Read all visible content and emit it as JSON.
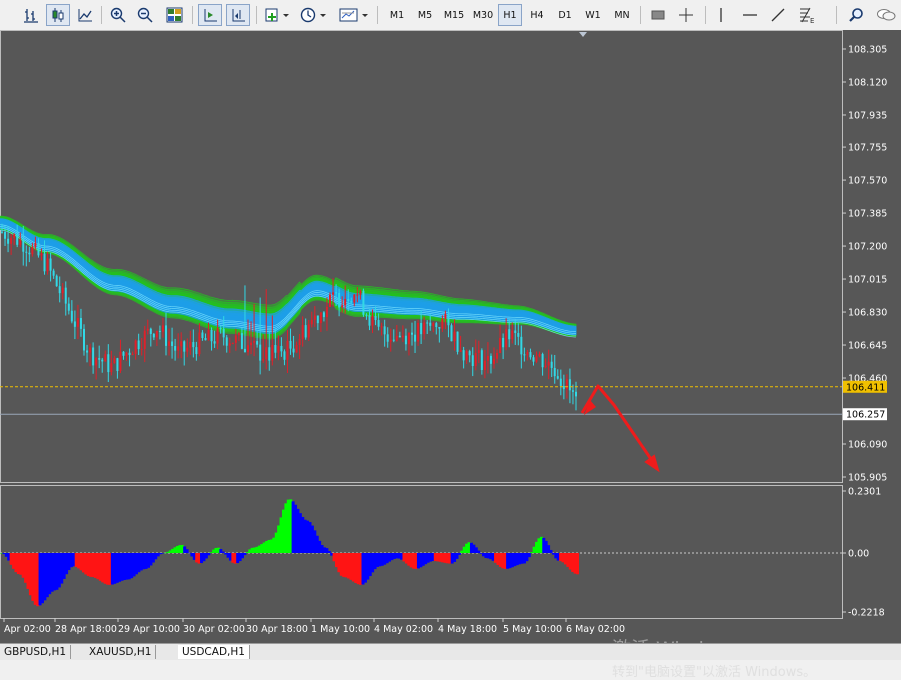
{
  "toolbar": {
    "timeframes": [
      "M1",
      "M5",
      "M15",
      "M30",
      "H1",
      "H4",
      "D1",
      "W1",
      "MN"
    ],
    "active_timeframe": "H1"
  },
  "icons": [
    "bar-chart-icon",
    "candlestick-icon",
    "line-chart-icon",
    "zoom-in-icon",
    "zoom-out-icon",
    "tile-windows-icon",
    "auto-scroll-icon",
    "chart-shift-icon",
    "indicators-icon",
    "periods-icon",
    "templates-icon",
    "rectangle-icon",
    "crosshair-icon",
    "vertical-line-icon",
    "horizontal-line-icon",
    "trendline-icon",
    "fibonacci-icon",
    "search-icon",
    "chat-icon"
  ],
  "colors": {
    "background": "#575757",
    "bull": "#e0202a",
    "bear": "#32d8e6",
    "ribbon_green": "#22c51e",
    "ribbon_blue": "#1e9ee8",
    "osc_red": "#ff1414",
    "osc_green": "#00ff00",
    "osc_blue": "#0000ff",
    "arrow": "#ee1c1c",
    "bid_line": "#f0c000"
  },
  "price_axis": {
    "labels": [
      "108.305",
      "108.120",
      "107.935",
      "107.755",
      "107.570",
      "107.385",
      "107.200",
      "107.015",
      "106.830",
      "106.645",
      "106.460",
      "106.090",
      "105.905"
    ],
    "current_price": "106.411",
    "bid_price": "106.257"
  },
  "indicator_axis": {
    "labels": [
      "0.2301",
      "0.00",
      "-0.2218"
    ]
  },
  "time_axis": {
    "labels": [
      "Apr 02:00",
      "28 Apr 18:00",
      "29 Apr 10:00",
      "30 Apr 02:00",
      "30 Apr 18:00",
      "1 May 10:00",
      "4 May 02:00",
      "4 May 18:00",
      "5 May 10:00",
      "6 May 02:00"
    ]
  },
  "tabs": [
    "GBPUSD,H1",
    "XAUUSD,H1",
    "USDCAD,H1"
  ],
  "active_tab": "USDCAD,H1",
  "watermark": {
    "line1": "激活 Windows",
    "line2": "转到\"电脑设置\"以激活 Windows。"
  },
  "chart_data": {
    "type": "candlestick",
    "symbol": "USDCAD,H1",
    "ylim": [
      105.905,
      108.305
    ],
    "x": [
      "Apr 02:00",
      "28 Apr 18:00",
      "29 Apr 10:00",
      "30 Apr 02:00",
      "30 Apr 18:00",
      "1 May 10:00",
      "4 May 02:00",
      "4 May 18:00",
      "5 May 10:00",
      "6 May 02:00"
    ],
    "close_series": [
      107.28,
      107.22,
      107.1,
      106.85,
      106.6,
      106.52,
      106.65,
      106.75,
      106.6,
      106.66,
      106.7,
      106.65,
      106.58,
      106.62,
      106.78,
      106.9,
      106.95,
      106.72,
      106.7,
      106.72,
      106.78,
      106.6,
      106.55,
      106.7,
      106.6,
      106.52,
      106.33
    ],
    "oscillator": {
      "ylim": [
        -0.2218,
        0.2301
      ],
      "values": [
        0.0,
        -0.08,
        -0.2,
        -0.14,
        -0.05,
        -0.09,
        -0.12,
        -0.1,
        -0.06,
        0.0,
        0.03,
        -0.04,
        0.02,
        -0.04,
        0.02,
        0.05,
        0.2,
        0.12,
        0.02,
        -0.09,
        -0.12,
        -0.05,
        -0.02,
        -0.06,
        -0.03,
        -0.04,
        0.04,
        -0.02,
        -0.06,
        -0.04,
        0.06,
        -0.03,
        -0.08
      ]
    }
  }
}
